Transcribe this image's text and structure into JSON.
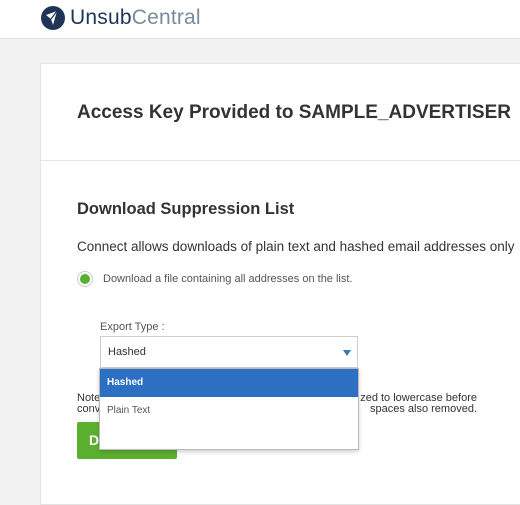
{
  "brand": {
    "name_part1": "Unsub",
    "name_part2": "Central"
  },
  "header": {
    "title": "Access Key Provided to SAMPLE_ADVERTISER"
  },
  "section": {
    "title": "Download Suppression List",
    "description": "Connect allows downloads of plain text and hashed email addresses only",
    "radio_label": "Download a file containing all addresses on the list.",
    "radio_selected": true
  },
  "export": {
    "label": "Export Type :",
    "selected_value": "Hashed",
    "options": [
      "Hashed",
      "Plain Text"
    ]
  },
  "note": {
    "line1_left": "Note",
    "line1_right": "zed to lowercase before",
    "line2_left": "conv",
    "line2_right": "spaces also removed."
  },
  "download_button": {
    "label_visible": "D"
  },
  "colors": {
    "accent_green": "#5cb030",
    "selected_option_blue": "#2d6fc2",
    "brand_dark": "#1f3558",
    "brand_gray": "#7a8a99"
  },
  "icons": {
    "logo": "unsubcentral-logo-icon",
    "caret": "chevron-down-icon",
    "radio": "radio-selected-icon"
  }
}
